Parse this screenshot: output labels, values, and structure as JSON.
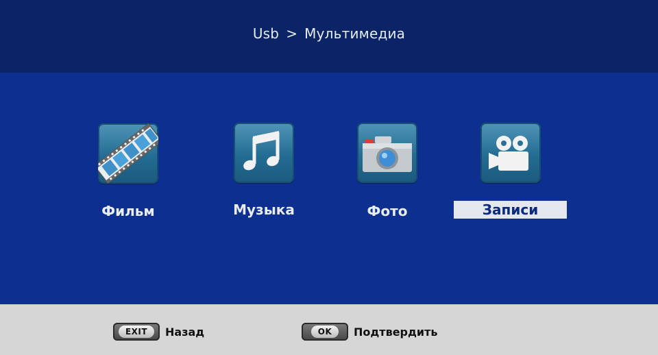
{
  "header": {
    "breadcrumb": [
      "Usb",
      ">",
      "Мультимедиа"
    ]
  },
  "menu": {
    "items": [
      {
        "label": "Фильм",
        "icon": "film-strip-icon",
        "selected": false
      },
      {
        "label": "Музыка",
        "icon": "music-note-icon",
        "selected": false
      },
      {
        "label": "Фото",
        "icon": "camera-icon",
        "selected": false
      },
      {
        "label": "Записи",
        "icon": "video-camera-icon",
        "selected": true
      }
    ]
  },
  "footer": {
    "exit_key": "EXIT",
    "exit_label": "Назад",
    "ok_key": "OK",
    "ok_label": "Подтвердить"
  },
  "colors": {
    "header_bg": "#0a2465",
    "main_bg": "#0d2f8f",
    "footer_bg": "#d6d6d6",
    "selected_bg": "#e4e7ee",
    "selected_text": "#0b2a7e"
  }
}
